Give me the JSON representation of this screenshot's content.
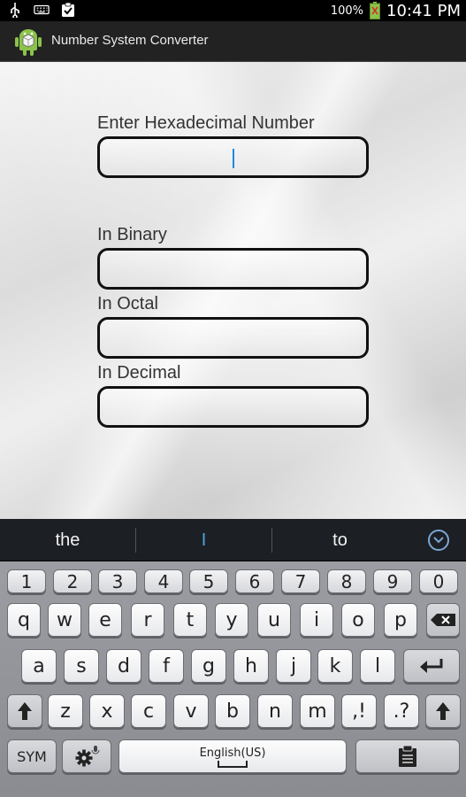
{
  "status_bar": {
    "battery_percent": "100%",
    "time": "10:41 PM",
    "icons": [
      "usb-icon",
      "keyboard-icon",
      "clipboard-check-icon",
      "battery-icon"
    ]
  },
  "action_bar": {
    "title": "Number System Converter",
    "icon": "android-icon"
  },
  "form": {
    "hex_label": "Enter Hexadecimal Number",
    "hex_value": "",
    "binary_label": "In Binary",
    "binary_value": "",
    "octal_label": "In Octal",
    "octal_value": "",
    "decimal_label": "In Decimal",
    "decimal_value": ""
  },
  "suggestions": {
    "left": "the",
    "center": "I",
    "right": "to",
    "collapse_icon": "chevron-down-icon"
  },
  "keyboard": {
    "row_numbers": [
      "1",
      "2",
      "3",
      "4",
      "5",
      "6",
      "7",
      "8",
      "9",
      "0"
    ],
    "row_1": [
      "q",
      "w",
      "e",
      "r",
      "t",
      "y",
      "u",
      "i",
      "o",
      "p"
    ],
    "row_2": [
      "a",
      "s",
      "d",
      "f",
      "g",
      "h",
      "j",
      "k",
      "l"
    ],
    "row_3": [
      "z",
      "x",
      "c",
      "v",
      "b",
      "n",
      "m"
    ],
    "comma_key": ",!",
    "period_key": ".?",
    "sym_key": "SYM",
    "space_label": "English(US)",
    "icons": {
      "backspace": "backspace-icon",
      "enter": "enter-icon",
      "shift": "shift-icon",
      "settings": "settings-mic-icon",
      "clipboard": "clipboard-icon"
    }
  }
}
